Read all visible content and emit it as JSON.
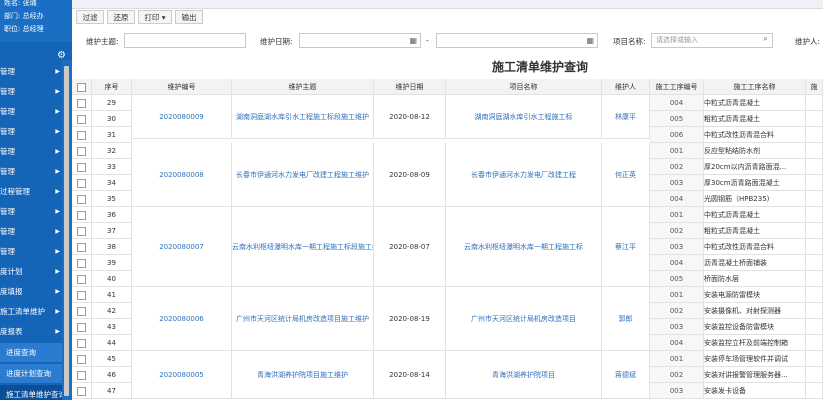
{
  "sidebar": {
    "name": "姓名: 张璐",
    "dept": "部门: 总经办",
    "position": "职位: 总经理",
    "items": [
      "管理",
      "管理",
      "管理",
      "管理",
      "管理",
      "管理",
      "过程管理",
      "管理",
      "管理",
      "管理",
      "度计划",
      "度填报",
      "施工清单维护",
      "度报表"
    ],
    "subitems": [
      "进度查询",
      "进度计划查询",
      "施工清单维护查询"
    ]
  },
  "toolbar": {
    "filter": "过滤",
    "restore": "还原",
    "print": "打印 ▾",
    "export": "输出"
  },
  "filters": {
    "topic_label": "维护主题:",
    "date_label": "维护日期:",
    "date_sep": "-",
    "project_label": "项目名称:",
    "project_placeholder": "请选择或输入",
    "maintainer_label": "维护人:"
  },
  "page_title": "施工清单维护查询",
  "table": {
    "headers": [
      "序号",
      "维护编号",
      "维护主题",
      "维护日期",
      "项目名称",
      "维护人",
      "施工工序编号",
      "施工工序名称",
      "施"
    ],
    "rownums": [
      "29",
      "30",
      "31",
      "32",
      "33",
      "34",
      "35",
      "36",
      "37",
      "38",
      "39",
      "40",
      "41",
      "42",
      "43",
      "44",
      "45",
      "46",
      "47"
    ],
    "groups": [
      {
        "code": "2020080009",
        "topic": "湖南洞庭湖水库引水工程施工标段施工维护",
        "date": "2020-08-12",
        "project": "湖南洞庭湖水库引水工程施工标",
        "person": "林康平"
      },
      {
        "code": "2020080008",
        "topic": "长春市伊通河水力发电厂改建工程施工维护",
        "date": "2020-08-09",
        "project": "长春市伊通河水力发电厂改建工程",
        "person": "何正英"
      },
      {
        "code": "2020080007",
        "topic": "云南水利枢纽瀑明水库一期工程施工标段施工维护",
        "date": "2020-08-07",
        "project": "云南水利枢纽瀑明水库一期工程施工标",
        "person": "蔡江平"
      },
      {
        "code": "2020080006",
        "topic": "广州市天河区统计局机房改造项目施工维护",
        "date": "2020-08-19",
        "project": "广州市天河区统计局机房改造项目",
        "person": "郭郎"
      },
      {
        "code": "2020080005",
        "topic": "青海洪湖养护院项目施工维护",
        "date": "2020-08-14",
        "project": "青海洪湖养护院项目",
        "person": "蒋德斌"
      }
    ],
    "steps": [
      [
        "004",
        "中粒式沥青混凝土"
      ],
      [
        "005",
        "粗粒式沥青混凝土"
      ],
      [
        "006",
        "中粒式改性沥青混合料"
      ],
      [
        "001",
        "反应型粘结防水剂"
      ],
      [
        "002",
        "厚20cm以内沥青路面混..."
      ],
      [
        "003",
        "厚30cm沥青路面混凝土"
      ],
      [
        "004",
        "光圆钢筋（HPB235)"
      ],
      [
        "001",
        "中粒式沥青混凝土"
      ],
      [
        "002",
        "粗粒式沥青混凝土"
      ],
      [
        "003",
        "中粒式改性沥青混合料"
      ],
      [
        "004",
        "沥青混凝土桥面铺装"
      ],
      [
        "005",
        "桥面防水层"
      ],
      [
        "001",
        "安装电源防雷模块"
      ],
      [
        "002",
        "安装摄像机、对射探测器"
      ],
      [
        "003",
        "安装监控设备防雷模块"
      ],
      [
        "004",
        "安装监控立杆及前端控制箱"
      ],
      [
        "001",
        "安装停车场管理软件并调试"
      ],
      [
        "002",
        "安装对讲报警管理服务器..."
      ],
      [
        "003",
        "安装发卡设备"
      ]
    ]
  }
}
